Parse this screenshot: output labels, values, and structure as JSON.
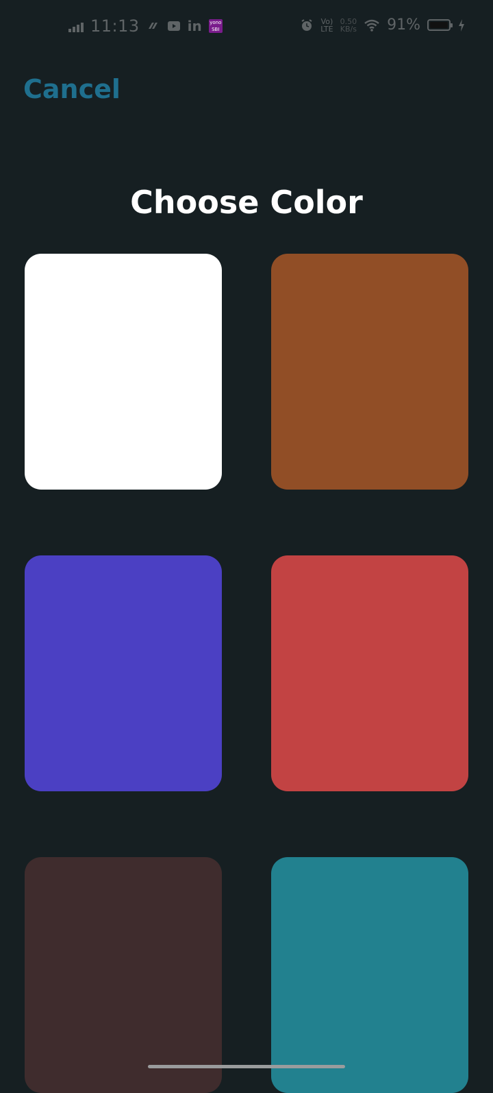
{
  "status_bar": {
    "time": "11:13",
    "lte_top": "Vo)",
    "lte_bottom": "LTE",
    "speed_value": "0.50",
    "speed_unit": "KB/s",
    "battery": "91%",
    "yono_label": "yono SBI",
    "linkedin": "in"
  },
  "header": {
    "cancel_label": "Cancel",
    "title": "Choose Color"
  },
  "colors": [
    {
      "name": "white",
      "hex": "#ffffff"
    },
    {
      "name": "brown",
      "hex": "#914e26"
    },
    {
      "name": "indigo",
      "hex": "#4b40c3"
    },
    {
      "name": "red",
      "hex": "#c24343"
    },
    {
      "name": "dark-brown",
      "hex": "#3f2c2d"
    },
    {
      "name": "teal",
      "hex": "#22818f"
    }
  ],
  "accent_color": "#1f6f8e",
  "background_color": "#161f22"
}
